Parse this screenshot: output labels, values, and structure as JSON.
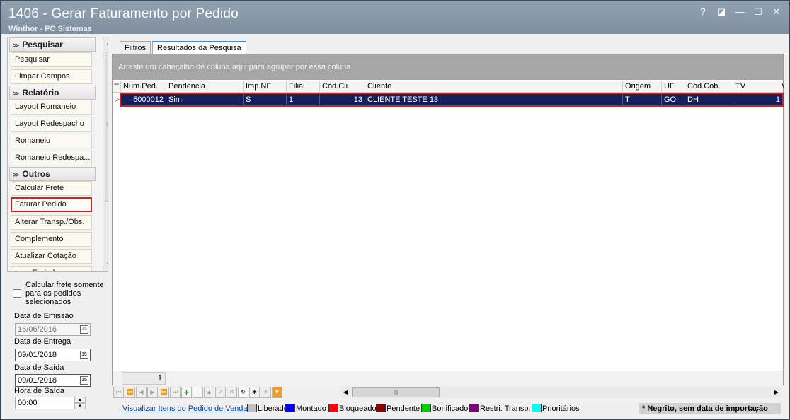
{
  "window": {
    "title": "1406 - Gerar Faturamento por Pedido",
    "subtitle": "Winthor - PC Sistemas",
    "buttons": {
      "help": "?",
      "restore": "◪",
      "minimize": "—",
      "maximize": "☐",
      "close": "✕"
    }
  },
  "sidebar": {
    "groups": [
      {
        "label": "Pesquisar",
        "items": [
          "Pesquisar",
          "Limpar Campos"
        ]
      },
      {
        "label": "Relatório",
        "items": [
          "Layout Romaneio",
          "Layout Redespacho",
          "Romaneio",
          "Romaneio Redespa..."
        ]
      },
      {
        "label": "Outros",
        "items": [
          "Calcular Frete",
          "Faturar Pedido",
          "Alterar Transp./Obs.",
          "Complemento",
          "Atualizar Cotação",
          "Imp. Ended..."
        ]
      }
    ],
    "selected_item": "Faturar Pedido"
  },
  "form": {
    "calc_frete_label": "Calcular frete somente para os pedidos selecionados",
    "calc_frete_checked": false,
    "data_emissao_label": "Data de Emissão",
    "data_emissao_value": "16/06/2016",
    "data_entrega_label": "Data de Entrega",
    "data_entrega_value": "09/01/2018",
    "data_saida_label": "Data de Saída",
    "data_saida_value": "09/01/2018",
    "hora_saida_label": "Hora de Saída",
    "hora_saida_value": "00:00",
    "calendar_glyph": "15"
  },
  "tabs": [
    "Filtros",
    "Resultados da Pesquisa"
  ],
  "active_tab": "Resultados da Pesquisa",
  "grid": {
    "group_hint": "Arraste um cabeçalho de coluna aqui para agrupar por essa coluna",
    "columns": [
      "Num.Ped.",
      "Pendência",
      "Imp.NF",
      "Filial",
      "Cód.Cli.",
      "Cliente",
      "Origem",
      "UF",
      "Cód.Cob.",
      "TV",
      "V"
    ],
    "rows": [
      [
        "5000012",
        "Sim",
        "S",
        "1",
        "13",
        "CLIENTE TESTE 13",
        "T",
        "GO",
        "DH",
        "1"
      ]
    ],
    "footer_count": "1"
  },
  "legend": {
    "link": "Visualizar Itens do Pedido de Venda",
    "items": [
      {
        "label": "Liberado",
        "color": "#c0c0c0"
      },
      {
        "label": "Montado",
        "color": "#0000ff"
      },
      {
        "label": "Bloqueado",
        "color": "#ff0000"
      },
      {
        "label": "Pendente",
        "color": "#8b0000"
      },
      {
        "label": "Bonificado",
        "color": "#00d000"
      },
      {
        "label": "Restri. Transp.",
        "color": "#800080"
      },
      {
        "label": "Prioritários",
        "color": "#00ffff"
      }
    ],
    "note": "* Negrito, sem data de importação"
  },
  "colors": {
    "titlebar": "#8a99a8",
    "selection_row": "#15215b",
    "highlight_border": "#e21b1b",
    "group_bar": "#a6a6a6"
  }
}
